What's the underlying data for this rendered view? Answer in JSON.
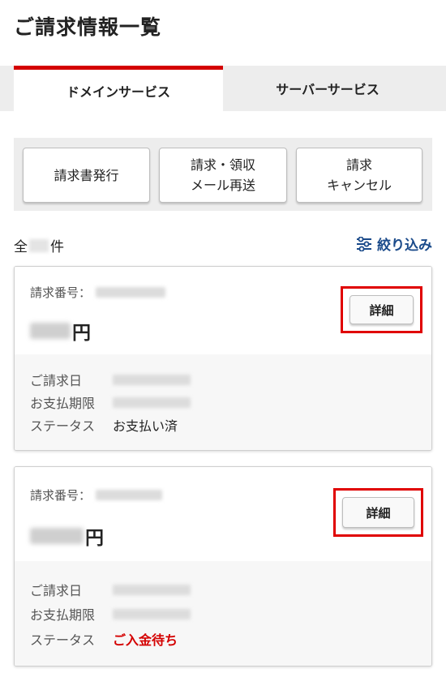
{
  "page": {
    "title": "ご請求情報一覧"
  },
  "tabs": [
    {
      "label": "ドメインサービス",
      "active": true
    },
    {
      "label": "サーバーサービス",
      "active": false
    }
  ],
  "actions": [
    {
      "label": "請求書発行"
    },
    {
      "label": "請求・領収\nメール再送"
    },
    {
      "label": "請求\nキャンセル"
    }
  ],
  "list": {
    "count_prefix": "全",
    "count_suffix": "件",
    "filter_label": "絞り込み",
    "filter_icon": "sliders-icon"
  },
  "invoices": [
    {
      "number_label": "請求番号：",
      "amount_unit": "円",
      "detail_label": "詳細",
      "fields": [
        {
          "key": "ご請求日"
        },
        {
          "key": "お支払期限"
        },
        {
          "key": "ステータス",
          "value": "お支払い済"
        }
      ]
    },
    {
      "number_label": "請求番号：",
      "amount_unit": "円",
      "detail_label": "詳細",
      "fields": [
        {
          "key": "ご請求日"
        },
        {
          "key": "お支払期限"
        },
        {
          "key": "ステータス",
          "value": "ご入金待ち"
        }
      ]
    }
  ],
  "colors": {
    "accent": "#d40000",
    "link": "#1a4a8a",
    "highlight_frame": "#e00000"
  }
}
